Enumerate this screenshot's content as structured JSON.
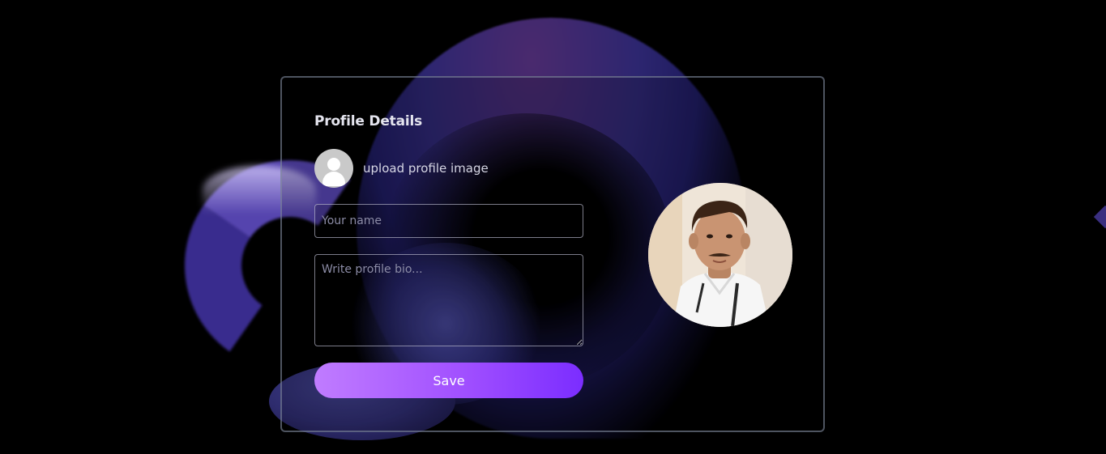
{
  "card": {
    "title": "Profile Details",
    "upload_label": "upload profile image",
    "name_placeholder": "Your name",
    "bio_placeholder": "Write profile bio...",
    "save_label": "Save"
  },
  "icons": {
    "avatar_placeholder": "user-silhouette-icon"
  },
  "colors": {
    "background": "#000000",
    "card_border": "#828ca0",
    "accent_start": "#c07cff",
    "accent_end": "#7b2dff",
    "blob_primary": "#2d2670",
    "blob_secondary": "#5a48b8"
  }
}
